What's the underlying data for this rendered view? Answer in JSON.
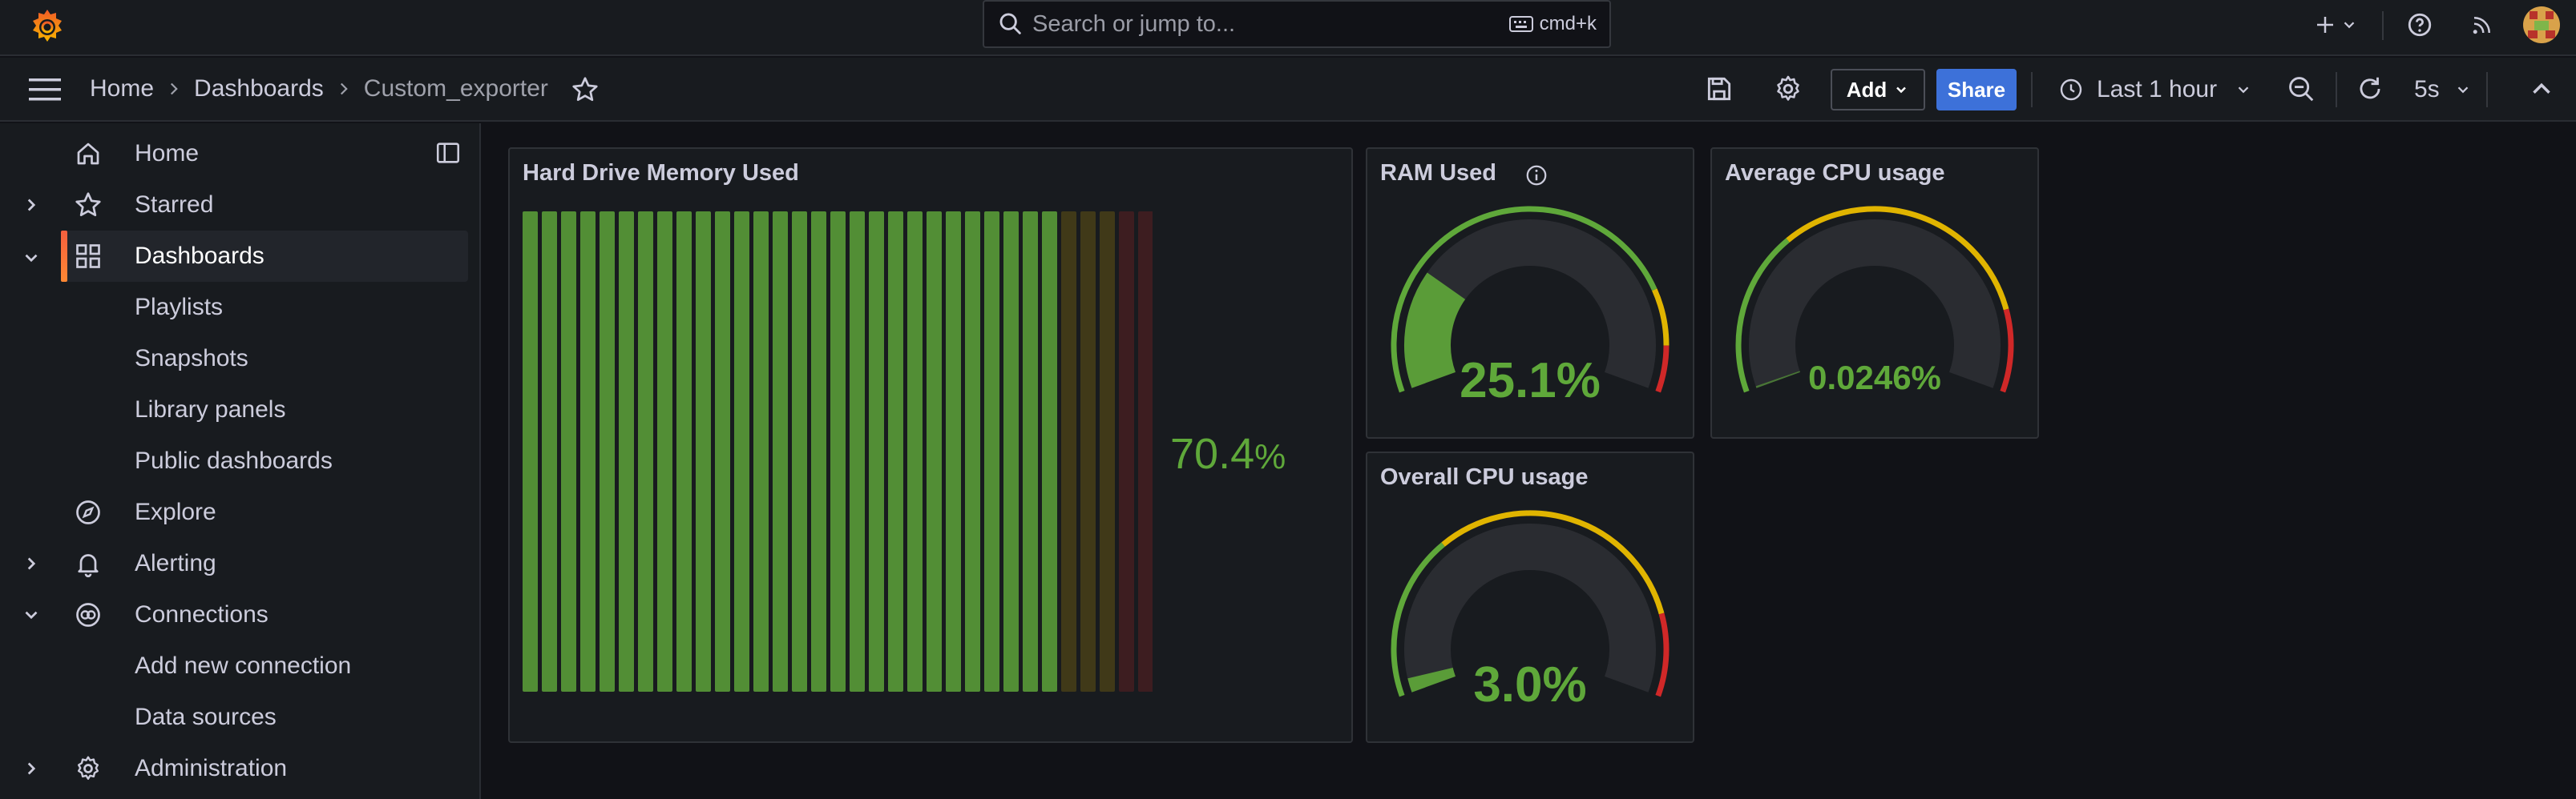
{
  "topbar": {
    "search_placeholder": "Search or jump to...",
    "search_shortcut": "cmd+k",
    "icons": [
      "grafana-logo-icon",
      "search-icon",
      "keyboard-icon",
      "plus-icon",
      "chevron-down-icon",
      "help-icon",
      "rss-icon",
      "avatar"
    ]
  },
  "navbar": {
    "breadcrumbs": [
      "Home",
      "Dashboards",
      "Custom_exporter"
    ],
    "add_label": "Add",
    "share_label": "Share",
    "time_range": "Last 1 hour",
    "refresh_interval": "5s"
  },
  "sidebar": {
    "items": [
      {
        "label": "Home",
        "icon": "home-icon",
        "expandable": false
      },
      {
        "label": "Starred",
        "icon": "star-icon",
        "expandable": true,
        "expanded": false
      },
      {
        "label": "Dashboards",
        "icon": "apps-icon",
        "expandable": true,
        "expanded": true,
        "active": true
      },
      {
        "label": "Playlists",
        "sub": true
      },
      {
        "label": "Snapshots",
        "sub": true
      },
      {
        "label": "Library panels",
        "sub": true
      },
      {
        "label": "Public dashboards",
        "sub": true
      },
      {
        "label": "Explore",
        "icon": "compass-icon",
        "expandable": false
      },
      {
        "label": "Alerting",
        "icon": "bell-icon",
        "expandable": true,
        "expanded": false
      },
      {
        "label": "Connections",
        "icon": "connections-icon",
        "expandable": true,
        "expanded": true
      },
      {
        "label": "Add new connection",
        "sub": true
      },
      {
        "label": "Data sources",
        "sub": true
      },
      {
        "label": "Administration",
        "icon": "cog-icon",
        "expandable": true,
        "expanded": false
      }
    ]
  },
  "panels": {
    "hdd": {
      "title": "Hard Drive Memory Used",
      "value": "70.4",
      "unit": "%",
      "fill_fraction": 0.704
    },
    "ram": {
      "title": "RAM Used",
      "value": "25.1%",
      "fill_fraction": 0.251
    },
    "avg_cpu": {
      "title": "Average CPU usage",
      "value": "0.0246%",
      "fill_fraction": 0.000246
    },
    "overall_cpu": {
      "title": "Overall CPU usage",
      "value": "3.0%",
      "fill_fraction": 0.03
    }
  },
  "colors": {
    "green": "#5fa83a",
    "yellow": "#e0b400",
    "red": "#d02828",
    "share_blue": "#3d71d9",
    "accent_orange": "#f55f3e"
  }
}
